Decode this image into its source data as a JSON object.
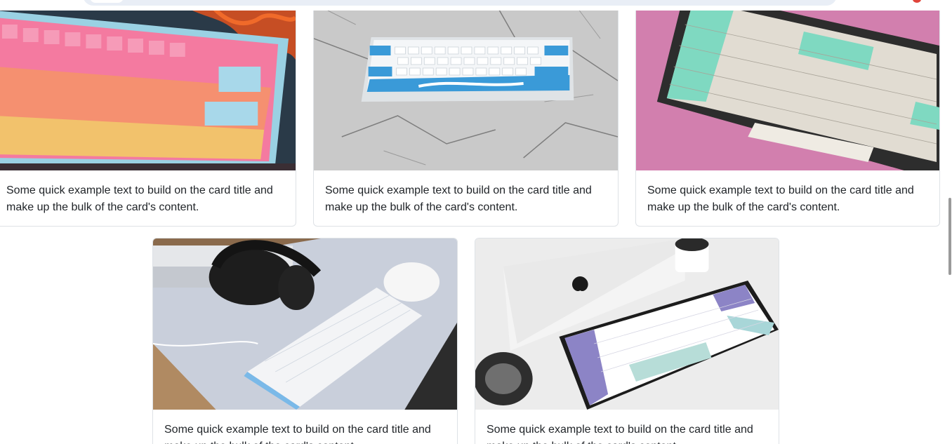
{
  "cards": [
    {
      "image_alt": "Pink orange and blue keycap keyboard",
      "text": "Some quick example text to build on the card title and make up the bulk of the card's content."
    },
    {
      "image_alt": "White and blue compact keyboard on marble",
      "text": "Some quick example text to build on the card title and make up the bulk of the card's content."
    },
    {
      "image_alt": "Mint and white keycap keyboard on pink background",
      "text": "Some quick example text to build on the card title and make up the bulk of the card's content."
    },
    {
      "image_alt": "White keyboard with black headphones and white mouse",
      "text": "Some quick example text to build on the card title and make up the bulk of the card's content."
    },
    {
      "image_alt": "Purple and white keyboard with laptop and plant",
      "text": "Some quick example text to build on the card title and make up the bulk of the card's content."
    }
  ]
}
